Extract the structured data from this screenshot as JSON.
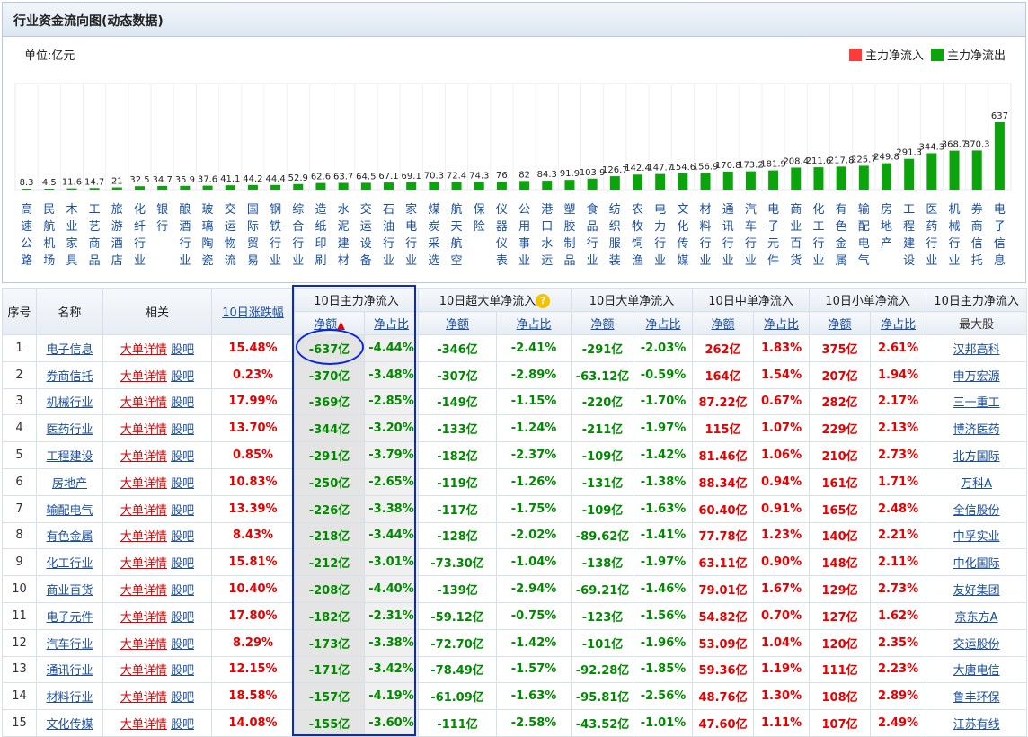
{
  "panel": {
    "title": "行业资金流向图(动态数据)",
    "unit": "单位:亿元"
  },
  "legend": [
    {
      "label": "主力净流入",
      "color": "#ff3a3a"
    },
    {
      "label": "主力净流出",
      "color": "#0ca40c"
    }
  ],
  "chart_data": {
    "type": "bar",
    "categories": [
      "高速公路",
      "民航机场",
      "木业家具",
      "工艺商品",
      "旅游酒店",
      "化纤行业",
      "银行",
      "酿酒行业",
      "玻璃陶瓷",
      "交运物流",
      "国际贸易",
      "钢铁行业",
      "综合行业",
      "造纸印刷",
      "水泥建材",
      "交运设备",
      "石油行业",
      "家电行业",
      "煤炭采选",
      "航天航空",
      "保险",
      "仪器仪表",
      "公用事业",
      "港口水运",
      "塑胶制品",
      "食品行业",
      "纺织服装",
      "农牧饲渔",
      "电力行业",
      "文化传媒",
      "材料行业",
      "通讯行业",
      "汽车行业",
      "电子元件",
      "商业百货",
      "化工行业",
      "有色金属",
      "输配电气",
      "房地产",
      "工程建设",
      "医药行业",
      "机械行业",
      "券商信托",
      "电子信息"
    ],
    "values": [
      8.3,
      4.5,
      11.6,
      14.7,
      21,
      32.5,
      34.7,
      35.9,
      37.6,
      41.1,
      44.2,
      44.4,
      52.9,
      62.6,
      63.7,
      64.5,
      67.1,
      69.1,
      70.3,
      72.4,
      74.3,
      76,
      82,
      84.3,
      91.9,
      103.9,
      126.7,
      142.4,
      147.7,
      154.6,
      156.9,
      170.8,
      173.2,
      181.9,
      208.4,
      211.6,
      217.8,
      225.7,
      249.8,
      291.3,
      344.3,
      368.7,
      370.3,
      637
    ],
    "labels": [
      "8.3",
      "4.5",
      "11.6",
      "14.7",
      "21",
      "32.5",
      "34.7",
      "35.9",
      "37.6",
      "41.1",
      "44.2",
      "44.4",
      "52.9",
      "62.6",
      "63.7",
      "64.5",
      "67.1",
      "69.1",
      "70.3",
      "72.4",
      "74.3",
      "76",
      "82",
      "84.3",
      "91.9",
      "103.9",
      "126.7",
      "142.4",
      "147.7",
      "154.6",
      "156.9",
      "170.8",
      "173.2",
      "181.9",
      "208.4",
      "211.6",
      "217.8",
      "225.7",
      "249.8",
      "291.3",
      "344.3",
      "368.7",
      "370.3",
      "637"
    ],
    "series_color": "#0ca40c",
    "ylim": [
      0,
      637
    ]
  },
  "table": {
    "headers": {
      "idx": "序号",
      "name": "名称",
      "related": "相关",
      "chg": "10日涨跌幅",
      "g1": "10日主力净流入",
      "g2": "10日超大单净流入",
      "g3": "10日大单净流入",
      "g4": "10日中单净流入",
      "g5": "10日小单净流入",
      "g6": "10日主力净流入",
      "g6sub": "最大股",
      "amt": "净额",
      "pct": "净占比"
    },
    "detail_label": "大单详情",
    "forum_label": "股吧",
    "rows": [
      {
        "idx": "1",
        "name": "电子信息",
        "chg": "15.48%",
        "main": "-637亿",
        "mainp": "-4.44%",
        "xl": "-346亿",
        "xlp": "-2.41%",
        "l": "-291亿",
        "lp": "-2.03%",
        "m": "262亿",
        "mp": "1.83%",
        "s": "375亿",
        "sp": "2.61%",
        "top": "汉邦高科"
      },
      {
        "idx": "2",
        "name": "券商信托",
        "chg": "0.23%",
        "main": "-370亿",
        "mainp": "-3.48%",
        "xl": "-307亿",
        "xlp": "-2.89%",
        "l": "-63.12亿",
        "lp": "-0.59%",
        "m": "164亿",
        "mp": "1.54%",
        "s": "207亿",
        "sp": "1.94%",
        "top": "申万宏源"
      },
      {
        "idx": "3",
        "name": "机械行业",
        "chg": "17.99%",
        "main": "-369亿",
        "mainp": "-2.85%",
        "xl": "-149亿",
        "xlp": "-1.15%",
        "l": "-220亿",
        "lp": "-1.70%",
        "m": "87.22亿",
        "mp": "0.67%",
        "s": "282亿",
        "sp": "2.17%",
        "top": "三一重工"
      },
      {
        "idx": "4",
        "name": "医药行业",
        "chg": "13.70%",
        "main": "-344亿",
        "mainp": "-3.20%",
        "xl": "-133亿",
        "xlp": "-1.24%",
        "l": "-211亿",
        "lp": "-1.97%",
        "m": "115亿",
        "mp": "1.07%",
        "s": "229亿",
        "sp": "2.13%",
        "top": "博济医药"
      },
      {
        "idx": "5",
        "name": "工程建设",
        "chg": "0.85%",
        "main": "-291亿",
        "mainp": "-3.79%",
        "xl": "-182亿",
        "xlp": "-2.37%",
        "l": "-109亿",
        "lp": "-1.42%",
        "m": "81.46亿",
        "mp": "1.06%",
        "s": "210亿",
        "sp": "2.73%",
        "top": "北方国际"
      },
      {
        "idx": "6",
        "name": "房地产",
        "chg": "10.83%",
        "main": "-250亿",
        "mainp": "-2.65%",
        "xl": "-119亿",
        "xlp": "-1.26%",
        "l": "-131亿",
        "lp": "-1.38%",
        "m": "88.34亿",
        "mp": "0.94%",
        "s": "161亿",
        "sp": "1.71%",
        "top": "万科A"
      },
      {
        "idx": "7",
        "name": "输配电气",
        "chg": "13.39%",
        "main": "-226亿",
        "mainp": "-3.38%",
        "xl": "-117亿",
        "xlp": "-1.75%",
        "l": "-109亿",
        "lp": "-1.63%",
        "m": "60.40亿",
        "mp": "0.91%",
        "s": "165亿",
        "sp": "2.48%",
        "top": "全信股份"
      },
      {
        "idx": "8",
        "name": "有色金属",
        "chg": "8.43%",
        "main": "-218亿",
        "mainp": "-3.44%",
        "xl": "-128亿",
        "xlp": "-2.02%",
        "l": "-89.62亿",
        "lp": "-1.41%",
        "m": "77.78亿",
        "mp": "1.23%",
        "s": "140亿",
        "sp": "2.21%",
        "top": "中孚实业"
      },
      {
        "idx": "9",
        "name": "化工行业",
        "chg": "15.81%",
        "main": "-212亿",
        "mainp": "-3.01%",
        "xl": "-73.30亿",
        "xlp": "-1.04%",
        "l": "-138亿",
        "lp": "-1.97%",
        "m": "63.11亿",
        "mp": "0.90%",
        "s": "148亿",
        "sp": "2.11%",
        "top": "中化国际"
      },
      {
        "idx": "10",
        "name": "商业百货",
        "chg": "10.40%",
        "main": "-208亿",
        "mainp": "-4.40%",
        "xl": "-139亿",
        "xlp": "-2.94%",
        "l": "-69.21亿",
        "lp": "-1.46%",
        "m": "79.01亿",
        "mp": "1.67%",
        "s": "129亿",
        "sp": "2.73%",
        "top": "友好集团"
      },
      {
        "idx": "11",
        "name": "电子元件",
        "chg": "17.80%",
        "main": "-182亿",
        "mainp": "-2.31%",
        "xl": "-59.12亿",
        "xlp": "-0.75%",
        "l": "-123亿",
        "lp": "-1.56%",
        "m": "54.82亿",
        "mp": "0.70%",
        "s": "127亿",
        "sp": "1.62%",
        "top": "京东方A"
      },
      {
        "idx": "12",
        "name": "汽车行业",
        "chg": "8.29%",
        "main": "-173亿",
        "mainp": "-3.38%",
        "xl": "-72.70亿",
        "xlp": "-1.42%",
        "l": "-101亿",
        "lp": "-1.96%",
        "m": "53.09亿",
        "mp": "1.04%",
        "s": "120亿",
        "sp": "2.35%",
        "top": "交运股份"
      },
      {
        "idx": "13",
        "name": "通讯行业",
        "chg": "12.15%",
        "main": "-171亿",
        "mainp": "-3.42%",
        "xl": "-78.49亿",
        "xlp": "-1.57%",
        "l": "-92.28亿",
        "lp": "-1.85%",
        "m": "59.36亿",
        "mp": "1.19%",
        "s": "111亿",
        "sp": "2.23%",
        "top": "大唐电信"
      },
      {
        "idx": "14",
        "name": "材料行业",
        "chg": "18.58%",
        "main": "-157亿",
        "mainp": "-4.19%",
        "xl": "-61.09亿",
        "xlp": "-1.63%",
        "l": "-95.81亿",
        "lp": "-2.56%",
        "m": "48.76亿",
        "mp": "1.30%",
        "s": "108亿",
        "sp": "2.89%",
        "top": "鲁丰环保"
      },
      {
        "idx": "15",
        "name": "文化传媒",
        "chg": "14.08%",
        "main": "-155亿",
        "mainp": "-3.60%",
        "xl": "-111亿",
        "xlp": "-2.58%",
        "l": "-43.52亿",
        "lp": "-1.01%",
        "m": "47.60亿",
        "mp": "1.11%",
        "s": "107亿",
        "sp": "2.49%",
        "top": "江苏有线"
      }
    ]
  }
}
